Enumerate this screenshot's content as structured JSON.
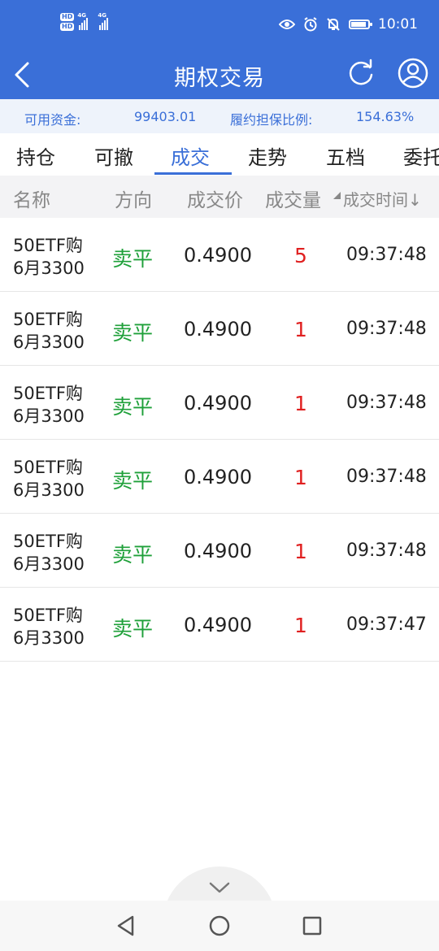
{
  "status_bar": {
    "hd1": "HD",
    "hd2": "HD",
    "network1": "4G",
    "network2": "4G",
    "time": "10:01",
    "icons": [
      "eye-icon",
      "alarm-icon",
      "silent-bell-icon",
      "battery-icon"
    ],
    "battery_level": 0.8
  },
  "header": {
    "title": "期权交易",
    "back_icon": "chevron-left-icon",
    "refresh_icon": "refresh-icon",
    "user_icon": "user-icon"
  },
  "funds": {
    "available_label": "可用资金:",
    "available_value": "99403.01",
    "margin_ratio_label": "履约担保比例:",
    "margin_ratio_value": "154.63%"
  },
  "tabs": [
    {
      "label": "持仓",
      "active": false
    },
    {
      "label": "可撤",
      "active": false
    },
    {
      "label": "成交",
      "active": true
    },
    {
      "label": "走势",
      "active": false
    },
    {
      "label": "五档",
      "active": false
    },
    {
      "label": "委托",
      "active": false
    }
  ],
  "columns": {
    "name": "名称",
    "direction": "方向",
    "price": "成交价",
    "quantity": "成交量",
    "time": "成交时间",
    "sort_indicator": "↓"
  },
  "trades": [
    {
      "name_line1": "50ETF购",
      "name_line2": "6月3300",
      "direction": "卖平",
      "price": "0.4900",
      "quantity": "5",
      "time": "09:37:48"
    },
    {
      "name_line1": "50ETF购",
      "name_line2": "6月3300",
      "direction": "卖平",
      "price": "0.4900",
      "quantity": "1",
      "time": "09:37:48"
    },
    {
      "name_line1": "50ETF购",
      "name_line2": "6月3300",
      "direction": "卖平",
      "price": "0.4900",
      "quantity": "1",
      "time": "09:37:48"
    },
    {
      "name_line1": "50ETF购",
      "name_line2": "6月3300",
      "direction": "卖平",
      "price": "0.4900",
      "quantity": "1",
      "time": "09:37:48"
    },
    {
      "name_line1": "50ETF购",
      "name_line2": "6月3300",
      "direction": "卖平",
      "price": "0.4900",
      "quantity": "1",
      "time": "09:37:48"
    },
    {
      "name_line1": "50ETF购",
      "name_line2": "6月3300",
      "direction": "卖平",
      "price": "0.4900",
      "quantity": "1",
      "time": "09:37:47"
    }
  ],
  "bottom": {
    "expand_icon": "chevron-down-icon",
    "nav_icons": [
      "back-triangle-icon",
      "home-circle-icon",
      "recents-square-icon"
    ]
  },
  "colors": {
    "primary": "#3a6fd8",
    "direction_green": "#1fa03a",
    "quantity_red": "#e02020"
  }
}
